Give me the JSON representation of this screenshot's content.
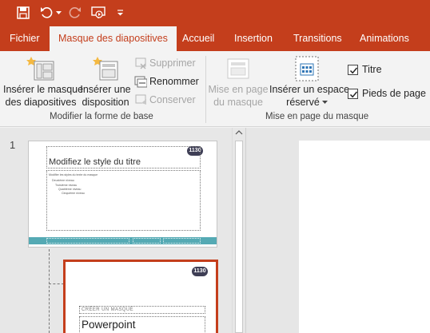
{
  "qat": {
    "icons": [
      "save-icon",
      "undo-icon",
      "undo-dropdown-icon",
      "redo-icon",
      "start-from-beginning-icon",
      "customize-qat-icon"
    ]
  },
  "tabs": [
    {
      "label": "Fichier"
    },
    {
      "label": "Masque des diapositives",
      "active": true
    },
    {
      "label": "Accueil"
    },
    {
      "label": "Insertion"
    },
    {
      "label": "Transitions"
    },
    {
      "label": "Animations"
    }
  ],
  "ribbon": {
    "groups": {
      "edit_master": {
        "label": "Modifier la forme de base",
        "insert_master": {
          "line1": "Insérer le masque",
          "line2": "des diapositives"
        },
        "insert_layout": {
          "line1": "Insérer une",
          "line2": "disposition"
        },
        "delete": "Supprimer",
        "rename": "Renommer",
        "preserve": "Conserver"
      },
      "master_layout": {
        "label": "Mise en page du masque",
        "layout_master": {
          "line1": "Mise en page",
          "line2": "du masque"
        },
        "insert_placeholder": {
          "line1": "Insérer un espace",
          "line2": "réservé"
        },
        "title_checkbox": {
          "label": "Titre",
          "checked": true
        },
        "footers_checkbox": {
          "label": "Pieds de page",
          "checked": true
        }
      }
    }
  },
  "thumbnails": {
    "slide_number": "1",
    "master": {
      "logo": "1130",
      "title": "Modifiez le style du titre",
      "body_lines": [
        "Modifier les styles du texte du masque",
        "Deuxième niveau",
        "Troisième niveau",
        "Quatrième niveau",
        "Cinquième niveau"
      ]
    },
    "layout": {
      "logo": "1130",
      "subtitle": "CRÉER UN MASQUE",
      "title": "Powerpoint"
    }
  },
  "colors": {
    "accent": "#c43e1c",
    "ribbon_bg": "#f3f3f3",
    "footer_bar": "#55aab4"
  }
}
